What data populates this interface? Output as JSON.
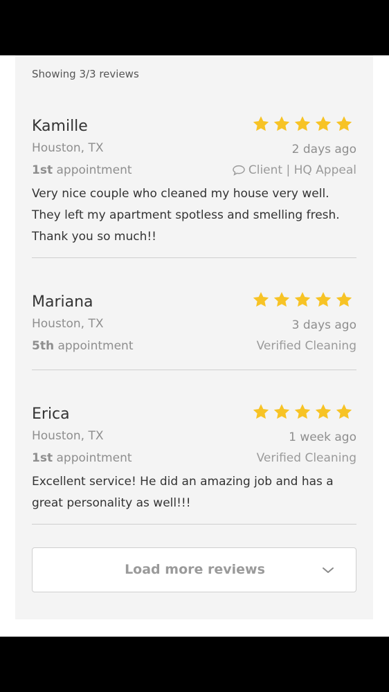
{
  "summary": {
    "showing": "Showing 3/3 reviews"
  },
  "reviews": [
    {
      "name": "Kamille",
      "rating": 5,
      "location": "Houston, TX",
      "time_ago": "2 days ago",
      "appointment_num": "1st",
      "appointment_word": "appointment",
      "source_icon": "chat-icon",
      "source": "Client | HQ Appeal",
      "text": "Very nice couple who cleaned my house very well. They left my apartment spotless and smelling fresh. Thank you so much!!"
    },
    {
      "name": "Mariana",
      "rating": 5,
      "location": "Houston, TX",
      "time_ago": "3 days ago",
      "appointment_num": "5th",
      "appointment_word": "appointment",
      "source": "Verified Cleaning",
      "text": ""
    },
    {
      "name": "Erica",
      "rating": 5,
      "location": "Houston, TX",
      "time_ago": "1 week ago",
      "appointment_num": "1st",
      "appointment_word": "appointment",
      "source": "Verified Cleaning",
      "text": "Excellent service! He did an amazing job and has a great personality as well!!!"
    }
  ],
  "load_more": {
    "label": "Load more reviews",
    "icon": "chevron-down-icon"
  },
  "colors": {
    "star": "#f7c325",
    "panel": "#f4f4f4",
    "text": "#333333",
    "muted": "#8e8e8e"
  }
}
